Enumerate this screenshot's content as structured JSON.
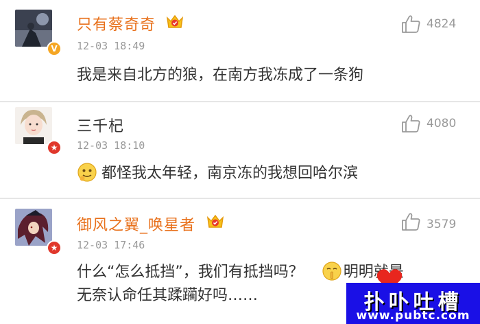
{
  "comments": [
    {
      "username": "只有蔡奇奇",
      "time": "12-03 18:49",
      "text": "我是来自北方的狼，在南方我冻成了一条狗",
      "likes": "4824",
      "username_color": "#e8711c",
      "badge": "verified-v-badge",
      "badge_color": "#f5a623",
      "badge_glyph": "V",
      "has_crown": true
    },
    {
      "username": "三千杞",
      "time": "12-03 18:10",
      "text": "都怪我太年轻，南京冻的我想回哈尔滨",
      "likes": "4080",
      "username_color": "#333333",
      "badge": "star-badge",
      "badge_color": "#e0372b",
      "badge_glyph": "★",
      "has_crown": false,
      "emoji": "smile-emoji"
    },
    {
      "username": "御风之翼_唤星者",
      "time": "12-03 17:46",
      "text_line1_a": "什么“怎么抵挡”，我们有抵挡吗？",
      "text_line1_b": "明明就是",
      "text_line2": "无奈认命任其蹂躏好吗……",
      "likes": "3579",
      "username_color": "#e8711c",
      "badge": "star-badge",
      "badge_color": "#e0372b",
      "badge_glyph": "★",
      "has_crown": true,
      "emoji": "shush-emoji"
    }
  ],
  "icons": {
    "like": "thumbs-up-icon",
    "crown": "vip-crown-icon"
  },
  "colors": {
    "accent": "#e8711c",
    "muted": "#999999",
    "separator": "#e6e6e6"
  },
  "watermark": {
    "title": "扑卟吐槽",
    "url": "www.pubtc.com"
  }
}
